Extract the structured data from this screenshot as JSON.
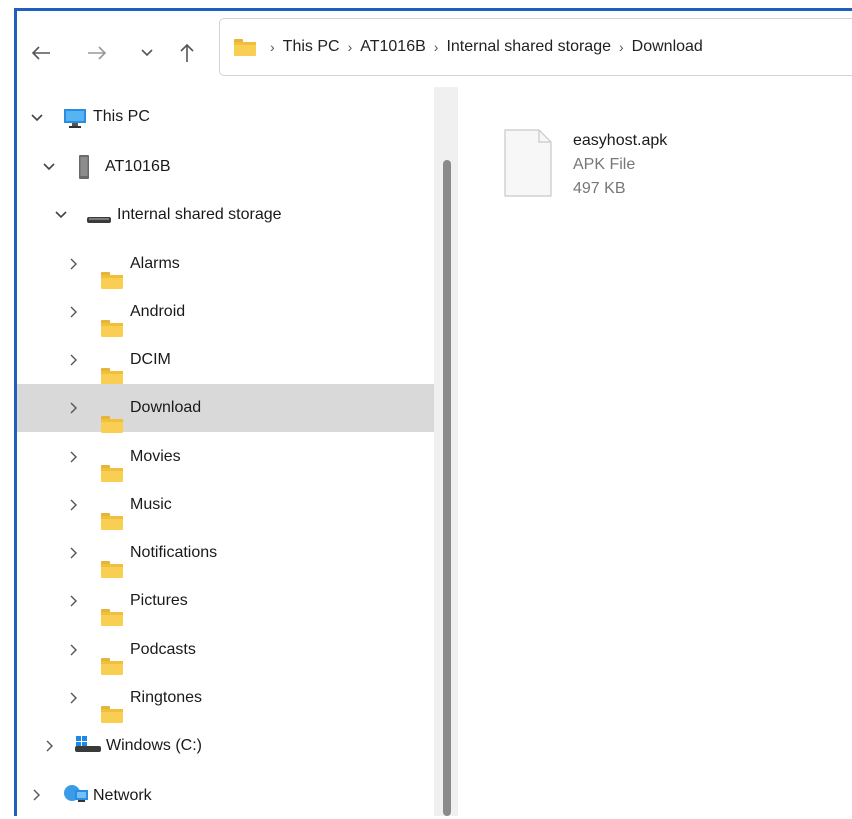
{
  "breadcrumb": {
    "items": [
      "This PC",
      "AT1016B",
      "Internal shared storage",
      "Download"
    ],
    "separator": "›"
  },
  "nav": {
    "this_pc": "This PC",
    "device": "AT1016B",
    "storage": "Internal shared storage",
    "folders": [
      "Alarms",
      "Android",
      "DCIM",
      "Download",
      "Movies",
      "Music",
      "Notifications",
      "Pictures",
      "Podcasts",
      "Ringtones"
    ],
    "selected_folder": "Download",
    "windows_drive": "Windows (C:)",
    "network": "Network"
  },
  "file": {
    "name": "easyhost.apk",
    "type": "APK File",
    "size": "497 KB"
  },
  "colors": {
    "accent": "#1f5fbf",
    "selection": "#d9d9d9",
    "folder": "#f8cf52"
  }
}
